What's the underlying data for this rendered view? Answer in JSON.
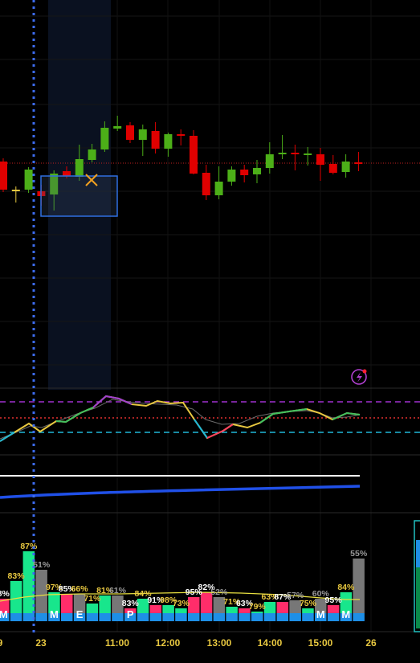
{
  "chart_data": [
    {
      "type": "candlestick",
      "title": "",
      "candles": [
        {
          "o": 201,
          "h": 197,
          "l": 239,
          "c": 236,
          "color": "#e00000"
        },
        {
          "o": 236,
          "h": 232,
          "l": 252,
          "c": 236,
          "color": "#e8c840"
        },
        {
          "o": 236,
          "h": 208,
          "l": 240,
          "c": 211,
          "color": "#4caf18"
        },
        {
          "o": 238,
          "h": 230,
          "l": 256,
          "c": 244,
          "color": "#e00000"
        },
        {
          "o": 242,
          "h": 212,
          "l": 262,
          "c": 216,
          "color": "#4caf18"
        },
        {
          "o": 213,
          "h": 207,
          "l": 222,
          "c": 219,
          "color": "#e00000"
        },
        {
          "o": 220,
          "h": 180,
          "l": 225,
          "c": 198,
          "color": "#4caf18"
        },
        {
          "o": 199,
          "h": 179,
          "l": 202,
          "c": 186,
          "color": "#4caf18"
        },
        {
          "o": 186,
          "h": 151,
          "l": 189,
          "c": 159,
          "color": "#4caf18"
        },
        {
          "o": 160,
          "h": 144,
          "l": 163,
          "c": 157,
          "color": "#4caf18"
        },
        {
          "o": 156,
          "h": 152,
          "l": 178,
          "c": 174,
          "color": "#e00000"
        },
        {
          "o": 174,
          "h": 155,
          "l": 194,
          "c": 161,
          "color": "#4caf18"
        },
        {
          "o": 163,
          "h": 152,
          "l": 191,
          "c": 185,
          "color": "#e00000"
        },
        {
          "o": 185,
          "h": 165,
          "l": 195,
          "c": 167,
          "color": "#4caf18"
        },
        {
          "o": 167,
          "h": 161,
          "l": 181,
          "c": 168,
          "color": "#e00000"
        },
        {
          "o": 169,
          "h": 162,
          "l": 217,
          "c": 216,
          "color": "#e00000"
        },
        {
          "o": 215,
          "h": 205,
          "l": 249,
          "c": 243,
          "color": "#e00000"
        },
        {
          "o": 243,
          "h": 207,
          "l": 248,
          "c": 226,
          "color": "#4caf18"
        },
        {
          "o": 226,
          "h": 207,
          "l": 231,
          "c": 211,
          "color": "#4caf18"
        },
        {
          "o": 211,
          "h": 205,
          "l": 227,
          "c": 218,
          "color": "#e00000"
        },
        {
          "o": 217,
          "h": 199,
          "l": 228,
          "c": 209,
          "color": "#4caf18"
        },
        {
          "o": 209,
          "h": 177,
          "l": 216,
          "c": 192,
          "color": "#4caf18"
        },
        {
          "o": 190,
          "h": 168,
          "l": 198,
          "c": 191,
          "color": "#4caf18"
        },
        {
          "o": 190,
          "h": 180,
          "l": 212,
          "c": 192,
          "color": "#e00000"
        },
        {
          "o": 191,
          "h": 183,
          "l": 206,
          "c": 192,
          "color": "#4caf18"
        },
        {
          "o": 192,
          "h": 184,
          "l": 225,
          "c": 205,
          "color": "#e00000"
        },
        {
          "o": 204,
          "h": 193,
          "l": 217,
          "c": 215,
          "color": "#e00000"
        },
        {
          "o": 214,
          "h": 192,
          "l": 221,
          "c": 201,
          "color": "#4caf18"
        },
        {
          "o": 202,
          "h": 189,
          "l": 213,
          "c": 202,
          "color": "#e00000"
        }
      ]
    },
    {
      "type": "bar",
      "title": "",
      "bars": [
        {
          "pct": "8%",
          "height": 28,
          "top_color": "#ff2d6a",
          "label_color": "#ffffff",
          "badge": "M"
        },
        {
          "pct": "83%",
          "height": 50,
          "top_color": "#18e68c",
          "label_color": "#e8c840",
          "badge": ""
        },
        {
          "pct": "87%",
          "height": 87,
          "top_color": "#18e68c",
          "label_color": "#e8c840",
          "badge": ""
        },
        {
          "pct": "51%",
          "height": 64,
          "top_color": "#777777",
          "label_color": "#9a9a9a",
          "badge": ""
        },
        {
          "pct": "97%",
          "height": 36,
          "top_color": "#18e68c",
          "label_color": "#e8c840",
          "badge": "M"
        },
        {
          "pct": "85%",
          "height": 34,
          "top_color": "#ff2d6a",
          "label_color": "#ffffff",
          "badge": ""
        },
        {
          "pct": "66%",
          "height": 34,
          "top_color": "#777777",
          "label_color": "#e8c840",
          "badge": "E"
        },
        {
          "pct": "71%",
          "height": 22,
          "top_color": "#18e68c",
          "label_color": "#e8c840",
          "badge": ""
        },
        {
          "pct": "81%",
          "height": 32,
          "top_color": "#18e68c",
          "label_color": "#e8c840",
          "badge": ""
        },
        {
          "pct": "61%",
          "height": 32,
          "top_color": "#777777",
          "label_color": "#9a9a9a",
          "badge": ""
        },
        {
          "pct": "83%",
          "height": 16,
          "top_color": "#ff2d6a",
          "label_color": "#ffffff",
          "badge": "P"
        },
        {
          "pct": "84%",
          "height": 28,
          "top_color": "#18e68c",
          "label_color": "#e8c840",
          "badge": ""
        },
        {
          "pct": "91%",
          "height": 20,
          "top_color": "#ff2d6a",
          "label_color": "#ffffff",
          "badge": ""
        },
        {
          "pct": "98%",
          "height": 20,
          "top_color": "#18e68c",
          "label_color": "#e8c840",
          "badge": ""
        },
        {
          "pct": "73%",
          "height": 16,
          "top_color": "#18e68c",
          "label_color": "#e8c840",
          "badge": ""
        },
        {
          "pct": "95%",
          "height": 30,
          "top_color": "#ff2d6a",
          "label_color": "#ffffff",
          "badge": ""
        },
        {
          "pct": "82%",
          "height": 36,
          "top_color": "#ff2d6a",
          "label_color": "#ffffff",
          "badge": ""
        },
        {
          "pct": "52%",
          "height": 30,
          "top_color": "#777777",
          "label_color": "#9a9a9a",
          "badge": ""
        },
        {
          "pct": "71%",
          "height": 18,
          "top_color": "#18e68c",
          "label_color": "#e8c840",
          "badge": ""
        },
        {
          "pct": "63%",
          "height": 16,
          "top_color": "#ff2d6a",
          "label_color": "#ffffff",
          "badge": ""
        },
        {
          "pct": "79%",
          "height": 12,
          "top_color": "#18e68c",
          "label_color": "#e8c840",
          "badge": ""
        },
        {
          "pct": "63%",
          "height": 24,
          "top_color": "#18e68c",
          "label_color": "#e8c840",
          "badge": ""
        },
        {
          "pct": "87%",
          "height": 24,
          "top_color": "#ff2d6a",
          "label_color": "#ffffff",
          "badge": ""
        },
        {
          "pct": "57%",
          "height": 26,
          "top_color": "#777777",
          "label_color": "#9a9a9a",
          "badge": ""
        },
        {
          "pct": "75%",
          "height": 16,
          "top_color": "#18e68c",
          "label_color": "#e8c840",
          "badge": ""
        },
        {
          "pct": "60%",
          "height": 28,
          "top_color": "#777777",
          "label_color": "#9a9a9a",
          "badge": "M"
        },
        {
          "pct": "95%",
          "height": 20,
          "top_color": "#ff2d6a",
          "label_color": "#ffffff",
          "badge": ""
        },
        {
          "pct": "84%",
          "height": 36,
          "top_color": "#18e68c",
          "label_color": "#e8c840",
          "badge": "M"
        },
        {
          "pct": "55%",
          "height": 78,
          "top_color": "#777777",
          "label_color": "#9a9a9a",
          "badge": ""
        }
      ]
    }
  ],
  "time_axis": {
    "labels": [
      "9",
      "23",
      "11:00",
      "12:00",
      "13:00",
      "14:00",
      "15:00",
      "26"
    ]
  },
  "colors": {
    "background": "#000000",
    "up": "#4caf18",
    "down": "#e00000",
    "crosshair": "#3d6cf0",
    "selection_box": "#2f6fe0",
    "volume_base": "#1e8fe6",
    "oscillator_upper": "#a030d0",
    "oscillator_lower": "#20b8d8",
    "oscillator_mid": "#e03030",
    "trend_line": "#2050e8",
    "avg_line": "#e8e040"
  },
  "icons": {
    "alert": "lightning-alert-icon",
    "marker": "x-marker-icon"
  }
}
